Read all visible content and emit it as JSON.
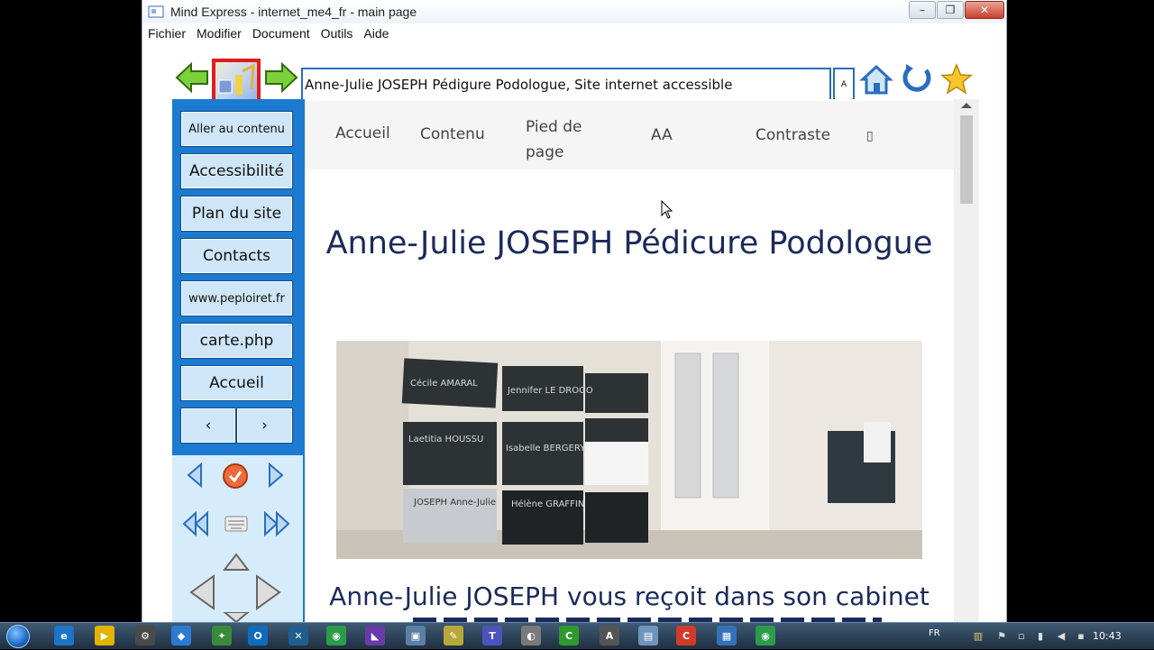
{
  "window": {
    "title": "Mind Express - internet_me4_fr - main page",
    "controls": {
      "minimize": "–",
      "maximize": "❐",
      "close": "✕"
    }
  },
  "menubar": [
    "Fichier",
    "Modifier",
    "Document",
    "Outils",
    "Aide"
  ],
  "toolbar": {
    "address": "Anne-Julie JOSEPH Pédigure Podologue, Site internet accessible",
    "font_button": "A"
  },
  "sidebar": {
    "buttons": [
      "Aller au contenu",
      "Accessibilité",
      "Plan du site",
      "Contacts",
      "www.peploiret.fr",
      "carte.php",
      "Accueil"
    ],
    "pager": {
      "prev": "‹",
      "next": "›"
    }
  },
  "site": {
    "nav": [
      "Accueil",
      "Contenu",
      "Pied de page",
      "AA",
      "Contraste",
      "▯"
    ],
    "heading": "Anne-Julie JOSEPH Pédicure Podologue",
    "subheading": "Anne-Julie JOSEPH vous reçoit dans son cabinet",
    "plaques": [
      "Cécile AMARAL",
      "Jennifer LE DROGO",
      "Laetitia HOUSSU",
      "Isabelle BERGERY",
      "JOSEPH Anne-Julie",
      "Hélène GRAFFIN"
    ]
  },
  "taskbar": {
    "lang": "FR",
    "time": "10:43"
  },
  "colors": {
    "sidebar_blue": "#1c7ad0",
    "button_fill": "#cfe6f8",
    "heading_navy": "#1b2a5a",
    "selection_red": "#e31b1b"
  }
}
